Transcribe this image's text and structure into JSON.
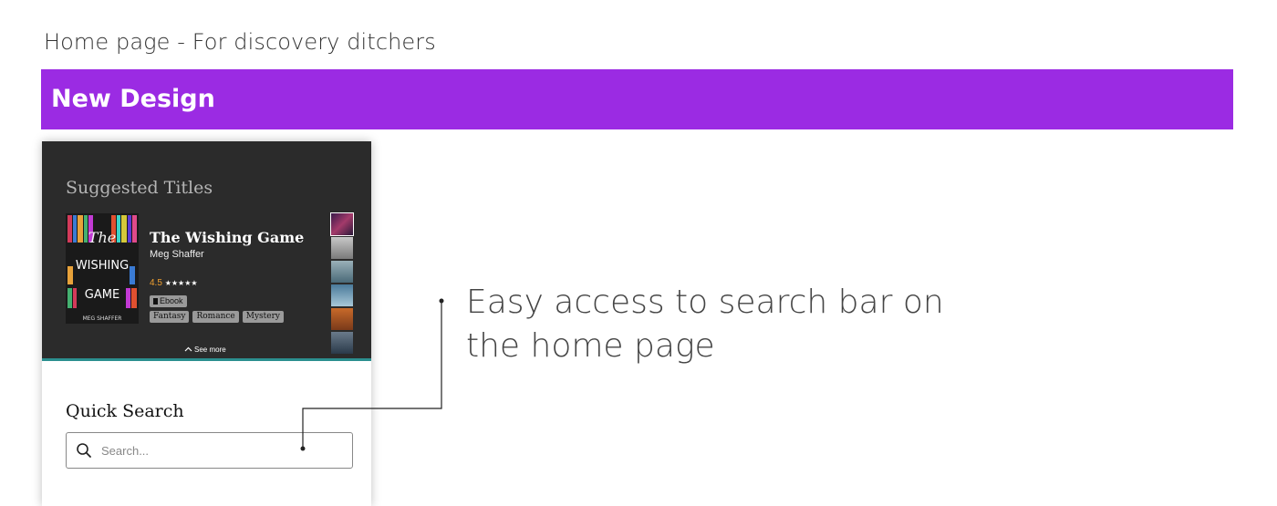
{
  "page": {
    "heading": "Home page - For discovery ditchers",
    "banner_title": "New Design",
    "banner_color": "#9b2be3"
  },
  "suggested": {
    "section_title": "Suggested Titles",
    "cover_text": {
      "line1": "The",
      "line2": "WISHING",
      "line3": "GAME",
      "author": "MEG SHAFFER"
    },
    "title": "The Wishing Game",
    "author": "Meg Shaffer",
    "rating_value": "4.5",
    "rating_stars": "★★★★★",
    "format_icon": "book-icon",
    "format": "Ebook",
    "genres": [
      "Fantasy",
      "Romance",
      "Mystery"
    ],
    "see_more": "See more",
    "accent_color": "#2b8f8f"
  },
  "quick_search": {
    "title": "Quick Search",
    "placeholder": "Search..."
  },
  "annotation": {
    "text": "Easy access to search bar on the home page"
  }
}
